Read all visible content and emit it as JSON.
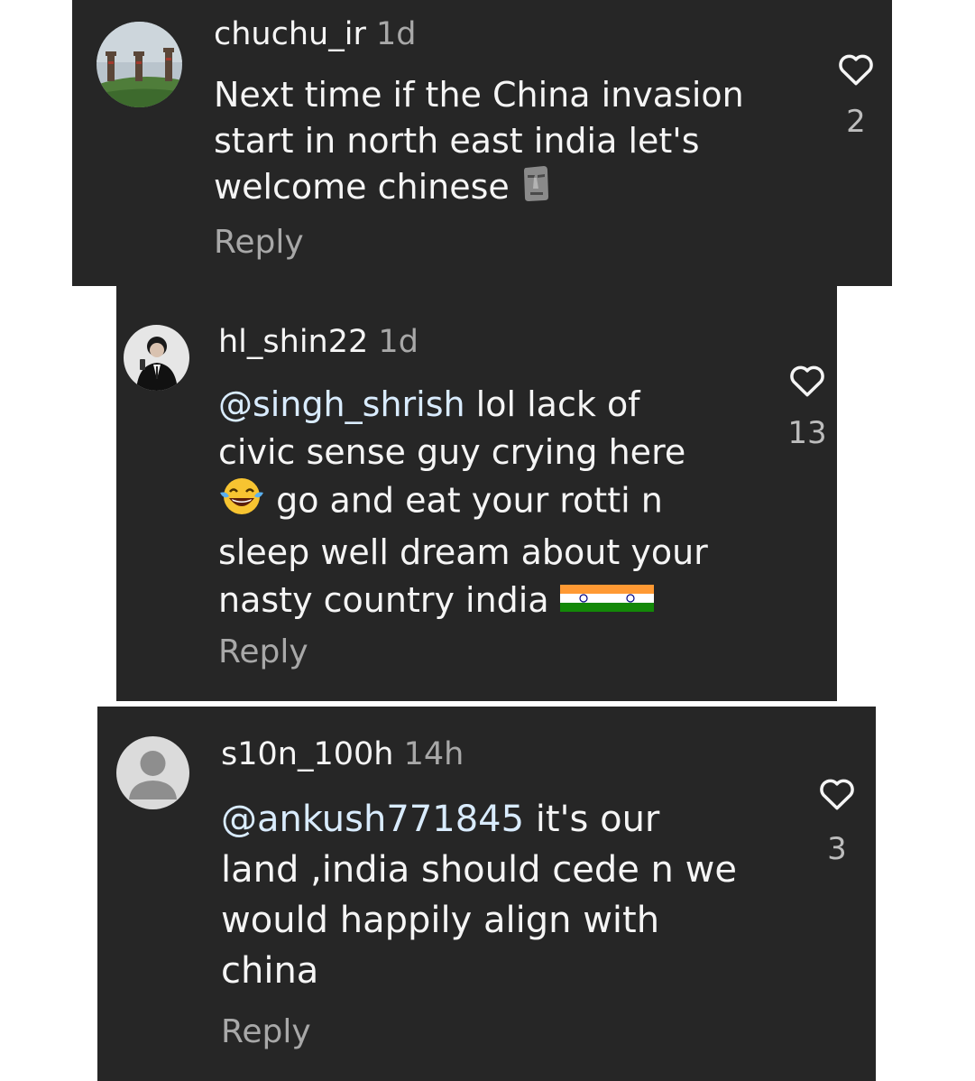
{
  "comments": [
    {
      "username": "chuchu_ir",
      "time": "1d",
      "text_parts": [
        "Next time if the China invasion",
        "start in north east india let's",
        "welcome chinese"
      ],
      "emoji": "moai",
      "reply_label": "Reply",
      "likes": "2",
      "avatar": "landscape-towers"
    },
    {
      "username": "hl_shin22",
      "time": "1d",
      "mention": "@singh_shrish",
      "text_line1_rest": " lol lack of",
      "text_line2": "civic sense guy crying here",
      "text_line3_rest": " go and eat your rotti n",
      "text_line4": "sleep well dream about your",
      "text_line5": "nasty country india",
      "emoji_laugh": "face-with-tears-of-joy",
      "emoji_flags": "india-flag",
      "reply_label": "Reply",
      "likes": "13",
      "avatar": "person-in-suit"
    },
    {
      "username": "s10n_100h",
      "time": "14h",
      "mention": "@ankush771845",
      "text_line1_rest": " it's our",
      "text_line2": "land ,india should cede n we",
      "text_line3": "would happily align with",
      "text_line4": "china",
      "reply_label": "Reply",
      "likes": "3",
      "avatar": "default-avatar"
    }
  ],
  "colors": {
    "card_bg": "#262626",
    "text": "#f5f5f5",
    "muted": "#a8a8a8"
  }
}
